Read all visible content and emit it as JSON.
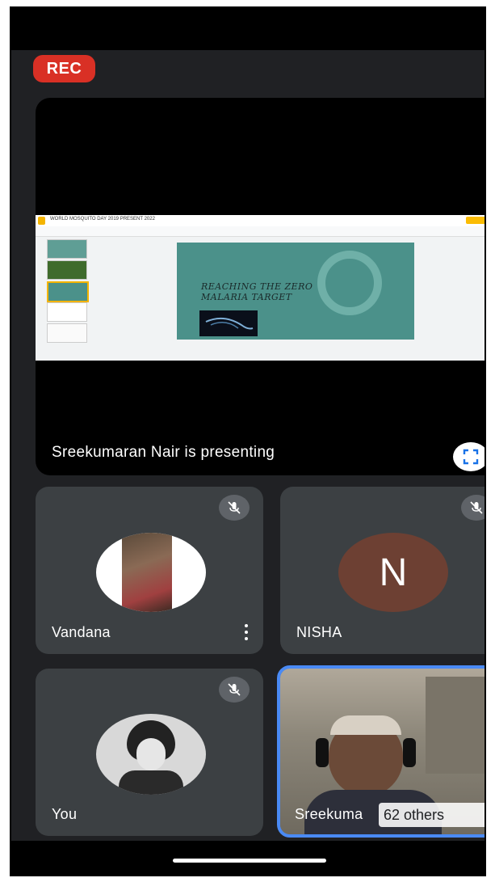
{
  "recording": {
    "label": "REC"
  },
  "presentation": {
    "status_text": "Sreekumaran Nair is presenting",
    "slide": {
      "doc_title": "WORLD MOSQUITO DAY 2019 PRESENT 2022",
      "heading_line1": "REACHING THE ZERO",
      "heading_line2": "MALARIA TARGET"
    }
  },
  "participants": [
    {
      "name": "Vandana",
      "muted": true
    },
    {
      "name": "NISHA",
      "initial": "N",
      "muted": true,
      "avatar_color": "#6d4033"
    },
    {
      "name": "You",
      "muted": true
    },
    {
      "name": "Sreekuma",
      "active_speaker": true,
      "others_label": "62 others"
    }
  ],
  "colors": {
    "rec": "#d93025",
    "tile": "#3c4043",
    "active_border": "#4a8af4"
  }
}
